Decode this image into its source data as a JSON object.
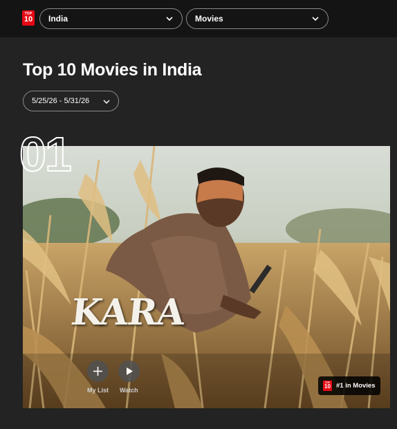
{
  "header": {
    "logo_top": "TOP",
    "logo_num": "10",
    "country_select": "India",
    "category_select": "Movies"
  },
  "main": {
    "title": "Top 10 Movies in India",
    "date_range": "5/25/26 - 5/31/26",
    "featured": {
      "rank": "01",
      "movie_title": "KARA",
      "my_list_label": "My List",
      "watch_label": "Watch",
      "badge_label": "#1 in Movies"
    }
  },
  "colors": {
    "brand_red": "#e50914",
    "page_bg": "#232323",
    "topbar_bg": "#141414"
  },
  "icons": [
    "top10-logo-icon",
    "chevron-down-icon",
    "plus-icon",
    "play-icon"
  ]
}
